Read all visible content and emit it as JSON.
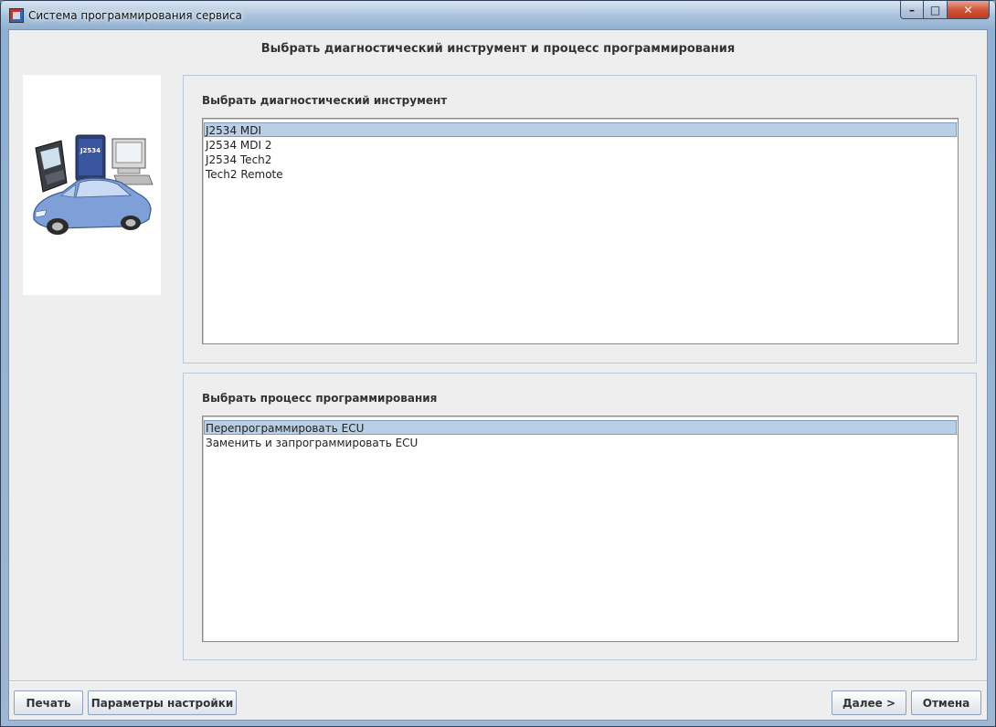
{
  "window": {
    "title": "Система программирования сервиса",
    "controls": {
      "minimize": "–",
      "maximize": "□",
      "close": "✕"
    }
  },
  "page": {
    "title": "Выбрать диагностический инструмент и процесс программирования"
  },
  "image": {
    "badge_text": "J2534"
  },
  "tool_panel": {
    "label": "Выбрать диагностический инструмент",
    "items": [
      {
        "label": "J2534 MDI",
        "selected": true
      },
      {
        "label": "J2534 MDI 2",
        "selected": false
      },
      {
        "label": "J2534 Tech2",
        "selected": false
      },
      {
        "label": "Tech2 Remote",
        "selected": false
      }
    ]
  },
  "process_panel": {
    "label": "Выбрать процесс программирования",
    "items": [
      {
        "label": "Перепрограммировать ECU",
        "selected": true
      },
      {
        "label": "Заменить и запрограммировать ECU",
        "selected": false
      }
    ]
  },
  "footer": {
    "print_label": "Печать",
    "settings_label": "Параметры настройки",
    "next_label": "Далее >",
    "cancel_label": "Отмена"
  },
  "colors": {
    "selection": "#b8cfe5",
    "background": "#eeeeee",
    "car": "#7e9fd8"
  }
}
